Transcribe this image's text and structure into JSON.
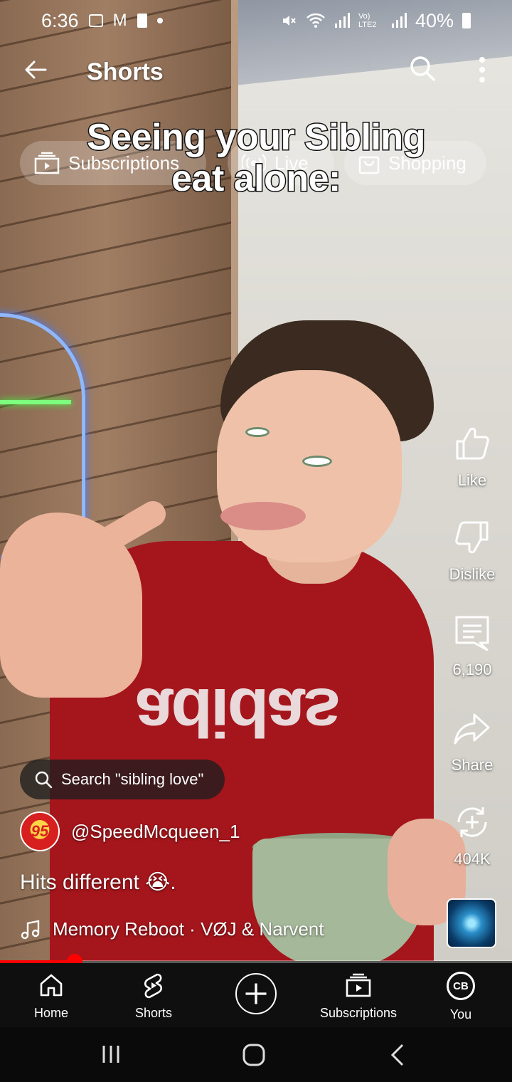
{
  "status_bar": {
    "time": "6:36",
    "battery": "40%",
    "left_icons": [
      "image-icon",
      "gmail-icon",
      "sd-card-icon",
      "dot-icon"
    ],
    "right_icons": [
      "mute-icon",
      "wifi-icon",
      "signal-icon",
      "volte-icon",
      "signal-icon",
      "battery-icon"
    ],
    "volte_label": "Vo) LTE2"
  },
  "top_bar": {
    "title": "Shorts",
    "back_icon": "arrow-left-icon",
    "search_icon": "search-icon",
    "more_icon": "more-vert-icon"
  },
  "feed_chips": [
    {
      "label": "Subscriptions",
      "icon": "subscriptions-icon"
    },
    {
      "label": "Live",
      "icon": "live-icon"
    },
    {
      "label": "Shopping",
      "icon": "shopping-bag-icon"
    }
  ],
  "video_overlay_text": [
    "Seeing your Sibling",
    "eat alone:"
  ],
  "actions": {
    "like": "Like",
    "dislike": "Dislike",
    "comments": "6,190",
    "share": "Share",
    "remix": "404K"
  },
  "search_suggestion": "Search \"sibling love\"",
  "channel": {
    "handle": "@SpeedMcqueen_1",
    "avatar_text": "95"
  },
  "video_title": "Hits different 😭.",
  "music": "Memory Reboot · VØJ & Narvent",
  "progress": 0.146,
  "bottom_nav": [
    {
      "label": "Home",
      "icon": "home-icon"
    },
    {
      "label": "Shorts",
      "icon": "shorts-icon"
    },
    {
      "label": "",
      "icon": "create-icon"
    },
    {
      "label": "Subscriptions",
      "icon": "subscriptions-icon"
    },
    {
      "label": "You",
      "icon": "avatar-icon",
      "avatar_text": "CB"
    }
  ],
  "colors": {
    "accent": "#ff0000",
    "nav_background": "#0f0f0f"
  }
}
